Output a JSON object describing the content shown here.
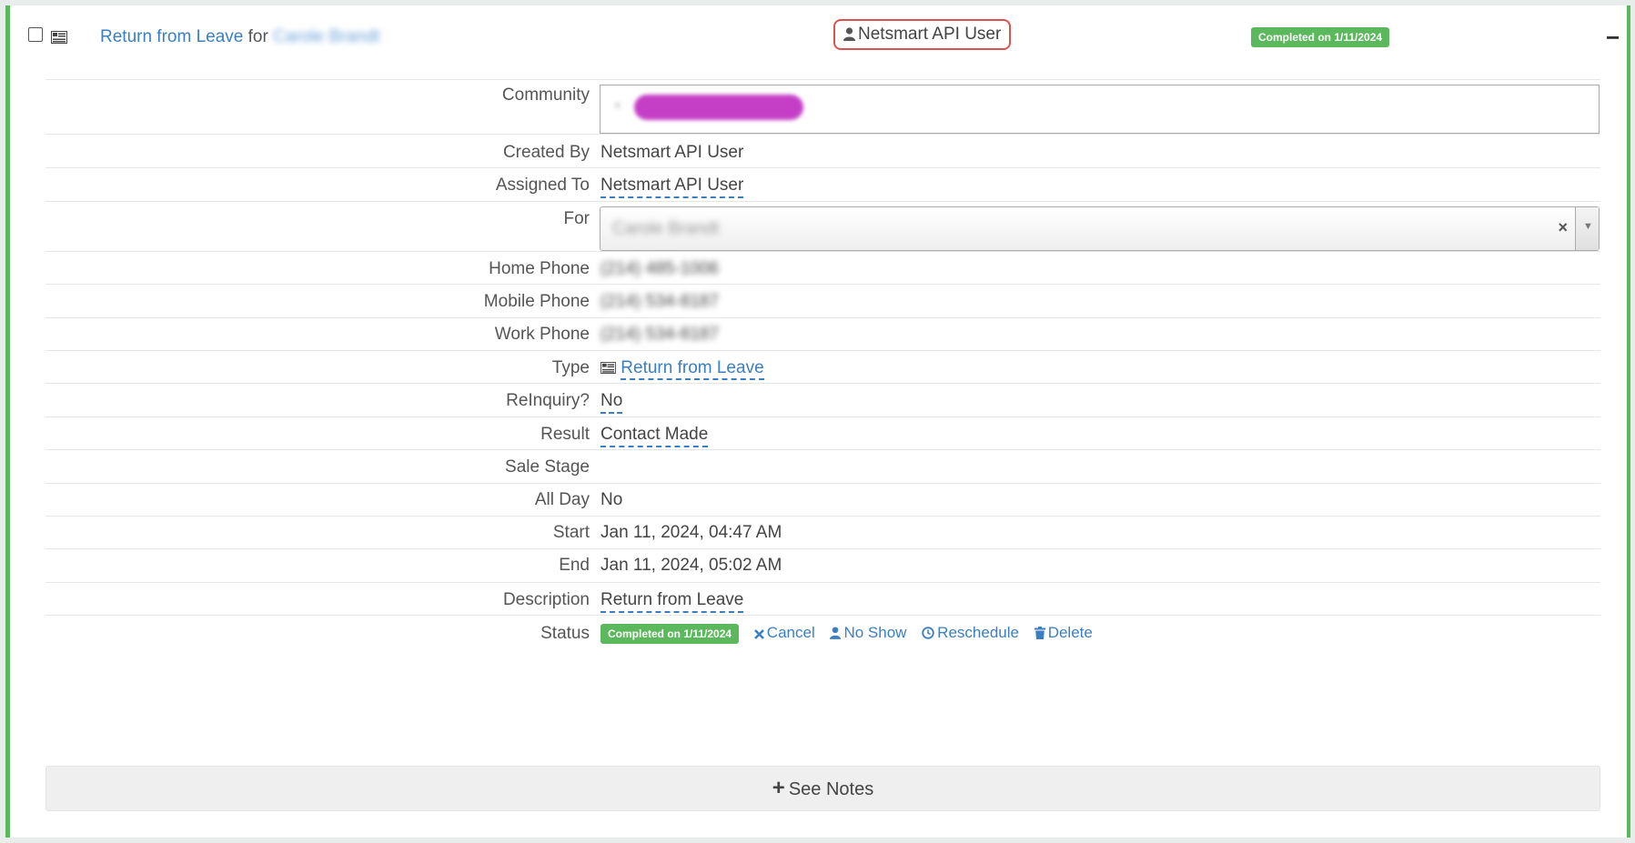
{
  "header": {
    "title_link": "Return from Leave",
    "for_word": "for",
    "for_name": "Carole Brandt",
    "owner": "Netsmart API User",
    "status_badge": "Completed on 1/11/2024",
    "collapse_symbol": "−"
  },
  "fields": {
    "community": {
      "label": "Community",
      "tag": "✖ Mission Pointe (3)",
      "tag_color": "#c43fc6"
    },
    "created_by": {
      "label": "Created By",
      "value": "Netsmart API User"
    },
    "assigned_to": {
      "label": "Assigned To",
      "value": "Netsmart API User"
    },
    "for": {
      "label": "For",
      "value": "Carole Brandt",
      "clear": "×",
      "arrow": "▼"
    },
    "home_phone": {
      "label": "Home Phone",
      "value": "(214) 485-1006"
    },
    "mobile_phone": {
      "label": "Mobile Phone",
      "value": "(214) 534-8187"
    },
    "work_phone": {
      "label": "Work Phone",
      "value": "(214) 534-8187"
    },
    "type": {
      "label": "Type",
      "value": "Return from Leave",
      "icon": "list-card-icon"
    },
    "reinquiry": {
      "label": "ReInquiry?",
      "value": "No"
    },
    "result": {
      "label": "Result",
      "value": "Contact Made"
    },
    "sale_stage": {
      "label": "Sale Stage",
      "value": ""
    },
    "all_day": {
      "label": "All Day",
      "value": "No"
    },
    "start": {
      "label": "Start",
      "value": "Jan 11, 2024, 04:47 AM"
    },
    "end": {
      "label": "End",
      "value": "Jan 11, 2024, 05:02 AM"
    },
    "description": {
      "label": "Description",
      "value": "Return from Leave"
    },
    "status": {
      "label": "Status",
      "badge": "Completed on 1/11/2024",
      "actions": {
        "cancel": "Cancel",
        "no_show": "No Show",
        "reschedule": "Reschedule",
        "delete": "Delete"
      }
    }
  },
  "notes_button": {
    "plus": "+",
    "label": "See Notes"
  },
  "colors": {
    "accent_green": "#5cb85c",
    "link_blue": "#3a7fc3",
    "highlight_red": "#d9534f"
  }
}
